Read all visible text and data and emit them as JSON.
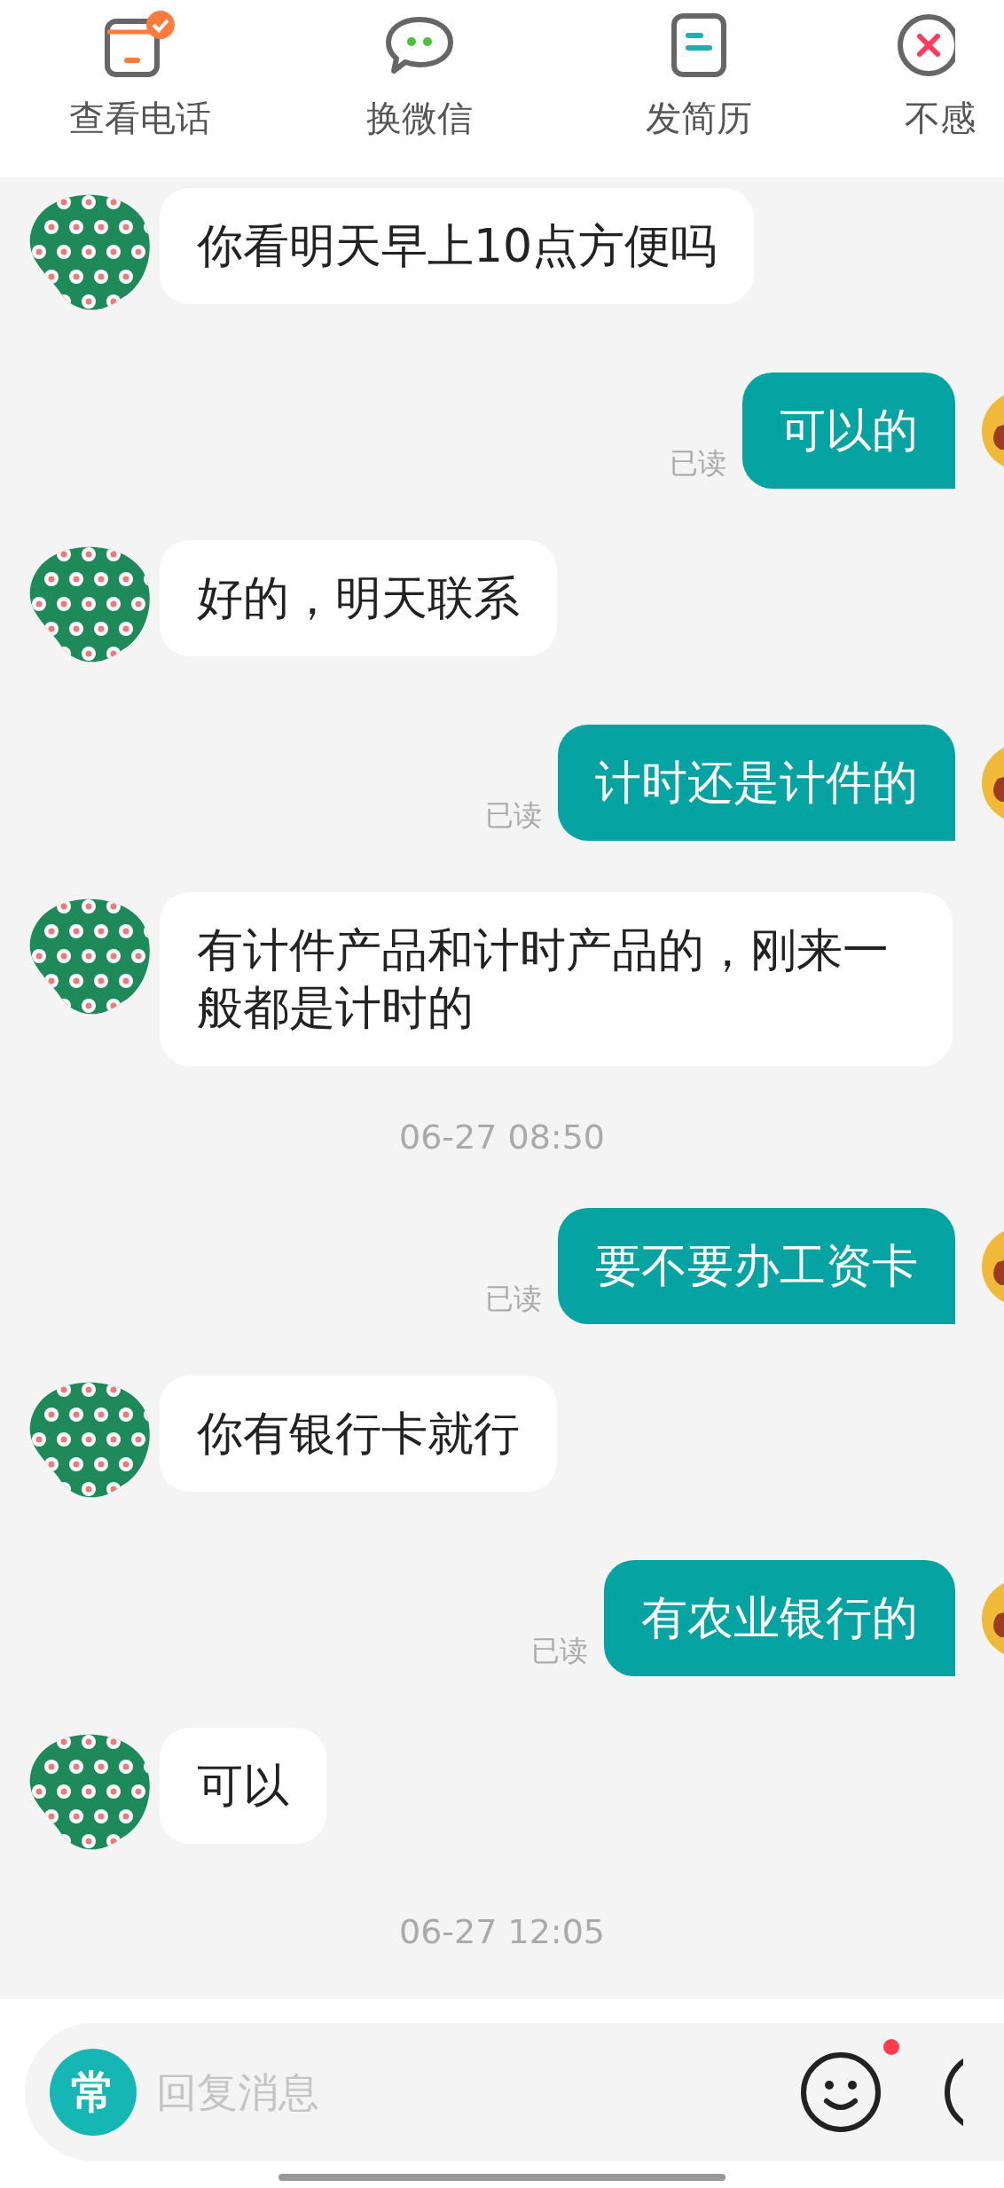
{
  "actions": [
    {
      "label": "查看电话",
      "kind": "phone"
    },
    {
      "label": "换微信",
      "kind": "wechat"
    },
    {
      "label": "发简历",
      "kind": "resume"
    },
    {
      "label": "不感",
      "kind": "dismiss"
    }
  ],
  "messages": [
    {
      "kind": "received",
      "text": "你看明天早上10点方便吗"
    },
    {
      "kind": "sent",
      "text": "可以的",
      "receipt": "已读"
    },
    {
      "kind": "received",
      "text": "好的，明天联系"
    },
    {
      "kind": "sent",
      "text": "计时还是计件的",
      "receipt": "已读"
    },
    {
      "kind": "received",
      "text": "有计件产品和计时产品的，刚来一般都是计时的"
    },
    {
      "kind": "time",
      "text": "06-27 08:50"
    },
    {
      "kind": "sent",
      "text": "要不要办工资卡",
      "receipt": "已读"
    },
    {
      "kind": "received",
      "text": "你有银行卡就行"
    },
    {
      "kind": "sent",
      "text": "有农业银行的",
      "receipt": "已读"
    },
    {
      "kind": "received",
      "text": "可以"
    },
    {
      "kind": "time",
      "text": "06-27 12:05"
    }
  ],
  "composer": {
    "badge": "常",
    "placeholder": "回复消息",
    "emoji_notification": true
  }
}
